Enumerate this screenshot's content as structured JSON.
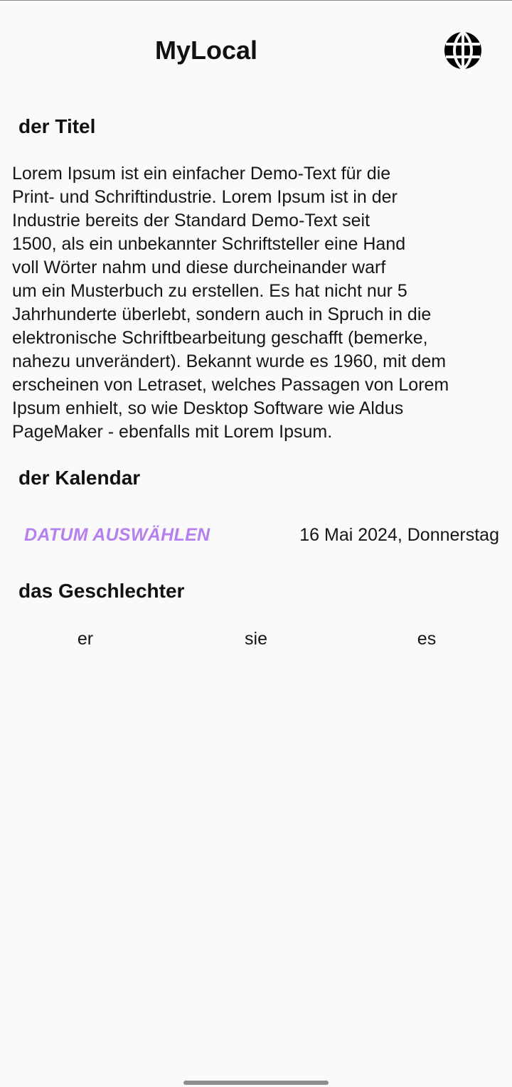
{
  "app_bar": {
    "title": "MyLocal",
    "language_icon": "globe-icon"
  },
  "title_section": {
    "heading": "der Titel",
    "lines": [
      "Lorem Ipsum ist ein einfacher Demo-Text für die",
      "Print- und Schriftindustrie. Lorem Ipsum ist in der",
      "Industrie bereits der Standard Demo-Text seit",
      "1500, als ein unbekannter Schriftsteller eine Hand",
      "voll Wörter nahm und diese durcheinander warf",
      "um ein Musterbuch zu erstellen. Es hat nicht nur 5",
      "Jahrhunderte überlebt, sondern auch in Spruch in die",
      "elektronische Schriftbearbeitung geschafft (bemerke,",
      "nahezu unverändert). Bekannt wurde es 1960, mit dem",
      "erscheinen von Letraset, welches Passagen von Lorem",
      "Ipsum enhielt, so wie Desktop Software wie Aldus",
      "PageMaker - ebenfalls mit Lorem Ipsum."
    ]
  },
  "calendar_section": {
    "heading": "der Kalendar",
    "button_label": "DATUM AUSWÄHLEN",
    "selected_date": "16 Mai 2024, Donnerstag"
  },
  "gender_section": {
    "heading": "das Geschlechter",
    "options": [
      "er",
      "sie",
      "es"
    ]
  },
  "colors": {
    "accent": "#b57ff0",
    "background": "#fafafa",
    "text": "#111111"
  }
}
